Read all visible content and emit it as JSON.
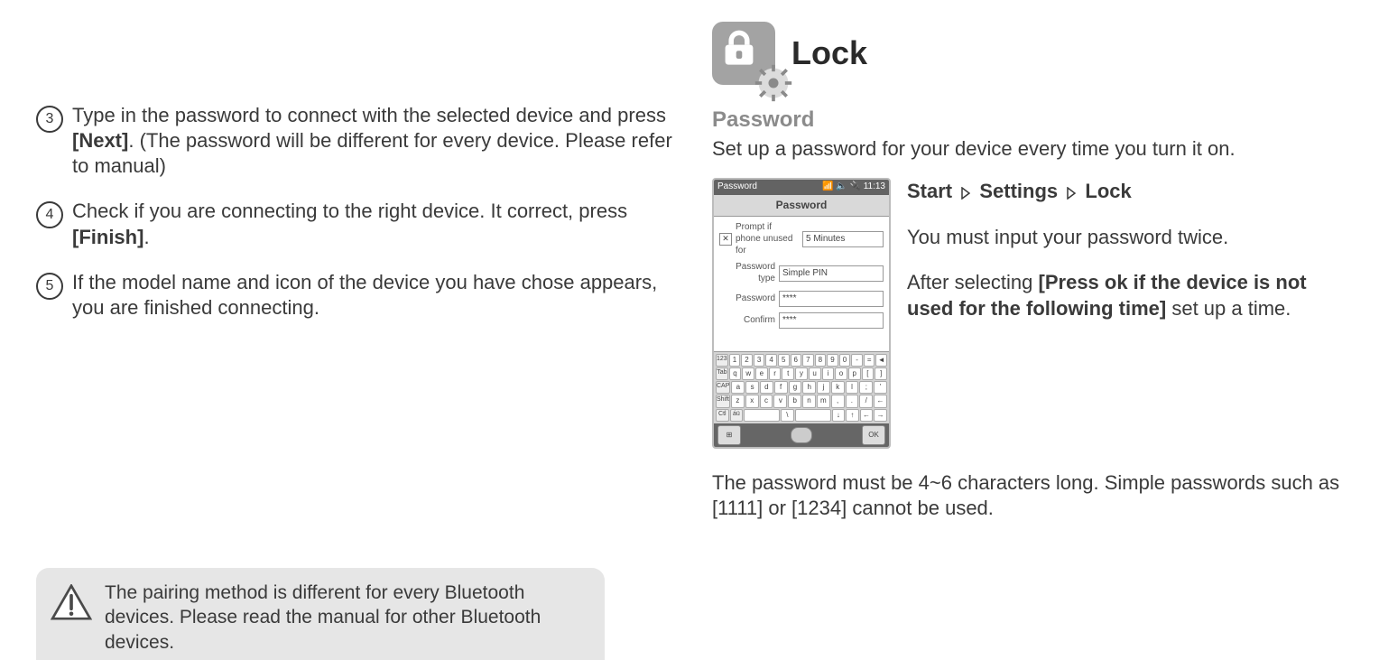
{
  "left": {
    "steps": [
      {
        "n": "3",
        "pre": "Type in the password to connect with the selected device and press ",
        "b1": "[Next]",
        "mid": ". (The password will be different for every device. Please refer to manual)",
        "b2": "",
        "post": ""
      },
      {
        "n": "4",
        "pre": "Check if you are connecting to the right device. It correct, press ",
        "b1": "[Finish]",
        "mid": ".",
        "b2": "",
        "post": ""
      },
      {
        "n": "5",
        "pre": "If the model name and icon of the device you have chose appears, you are finished connecting.",
        "b1": "",
        "mid": "",
        "b2": "",
        "post": ""
      }
    ],
    "notice": "The pairing method is different for every Bluetooth devices. Please read the manual for other Bluetooth devices."
  },
  "right": {
    "title": "Lock",
    "subhead": "Password",
    "intro": "Set up a password for your device every time you turn it on.",
    "nav": {
      "a": "Start",
      "b": "Settings",
      "c": "Lock"
    },
    "instr1": "You must input your password twice.",
    "instr2_pre": "After selecting ",
    "instr2_bold": "[Press ok if the device is not used for the following time]",
    "instr2_post": " set up a time.",
    "outro": "The password must be 4~6 characters long. Simple passwords such as [1111] or [1234] cannot be used.",
    "phone": {
      "top_left": "Password",
      "top_right": "11:13",
      "titlebar": "Password",
      "row1_lbl": "Prompt if phone unused  for",
      "row1_val": "5 Minutes",
      "row2_lbl": "Password type",
      "row2_val": "Simple PIN",
      "row3_lbl": "Password",
      "row3_val": "****",
      "row4_lbl": "Confirm",
      "row4_val": "****",
      "kb_rows": [
        [
          "123",
          "1",
          "2",
          "3",
          "4",
          "5",
          "6",
          "7",
          "8",
          "9",
          "0",
          "-",
          "=",
          "◄"
        ],
        [
          "Tab",
          "q",
          "w",
          "e",
          "r",
          "t",
          "y",
          "u",
          "i",
          "o",
          "p",
          "[",
          "]"
        ],
        [
          "CAP",
          "a",
          "s",
          "d",
          "f",
          "g",
          "h",
          "j",
          "k",
          "l",
          ";",
          "'"
        ],
        [
          "Shift",
          "z",
          "x",
          "c",
          "v",
          "b",
          "n",
          "m",
          ",",
          ".",
          "/",
          "←"
        ],
        [
          "Ctl",
          "áü",
          " ",
          "\\",
          " ",
          "↓",
          "↑",
          "←",
          "→"
        ]
      ],
      "ok": "OK"
    }
  }
}
